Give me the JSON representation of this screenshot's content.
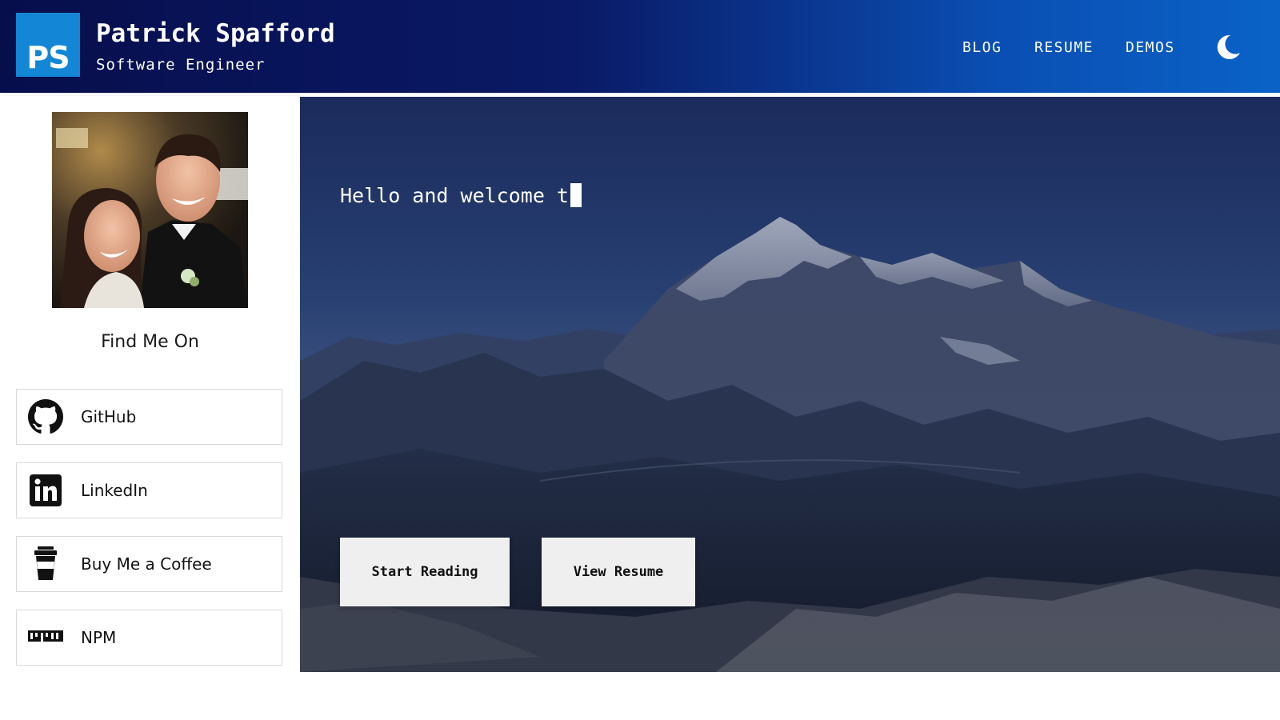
{
  "header": {
    "logo_text": "PS",
    "name": "Patrick Spafford",
    "tagline": "Software Engineer",
    "nav": [
      {
        "label": "BLOG"
      },
      {
        "label": "RESUME"
      },
      {
        "label": "DEMOS"
      }
    ],
    "theme_toggle_icon": "moon-icon"
  },
  "sidebar": {
    "find_me_heading": "Find Me On",
    "links": [
      {
        "label": "GitHub",
        "icon": "github-icon"
      },
      {
        "label": "LinkedIn",
        "icon": "linkedin-icon"
      },
      {
        "label": "Buy Me a Coffee",
        "icon": "coffee-cup-icon"
      },
      {
        "label": "NPM",
        "icon": "npm-icon"
      }
    ]
  },
  "hero": {
    "typed_text": "Hello and welcome t",
    "buttons": [
      {
        "label": "Start Reading"
      },
      {
        "label": "View Resume"
      }
    ]
  },
  "colors": {
    "header_dark": "#070e4c",
    "header_light": "#0a62c7",
    "logo_bg": "#1386d6",
    "button_bg": "#efefef"
  }
}
